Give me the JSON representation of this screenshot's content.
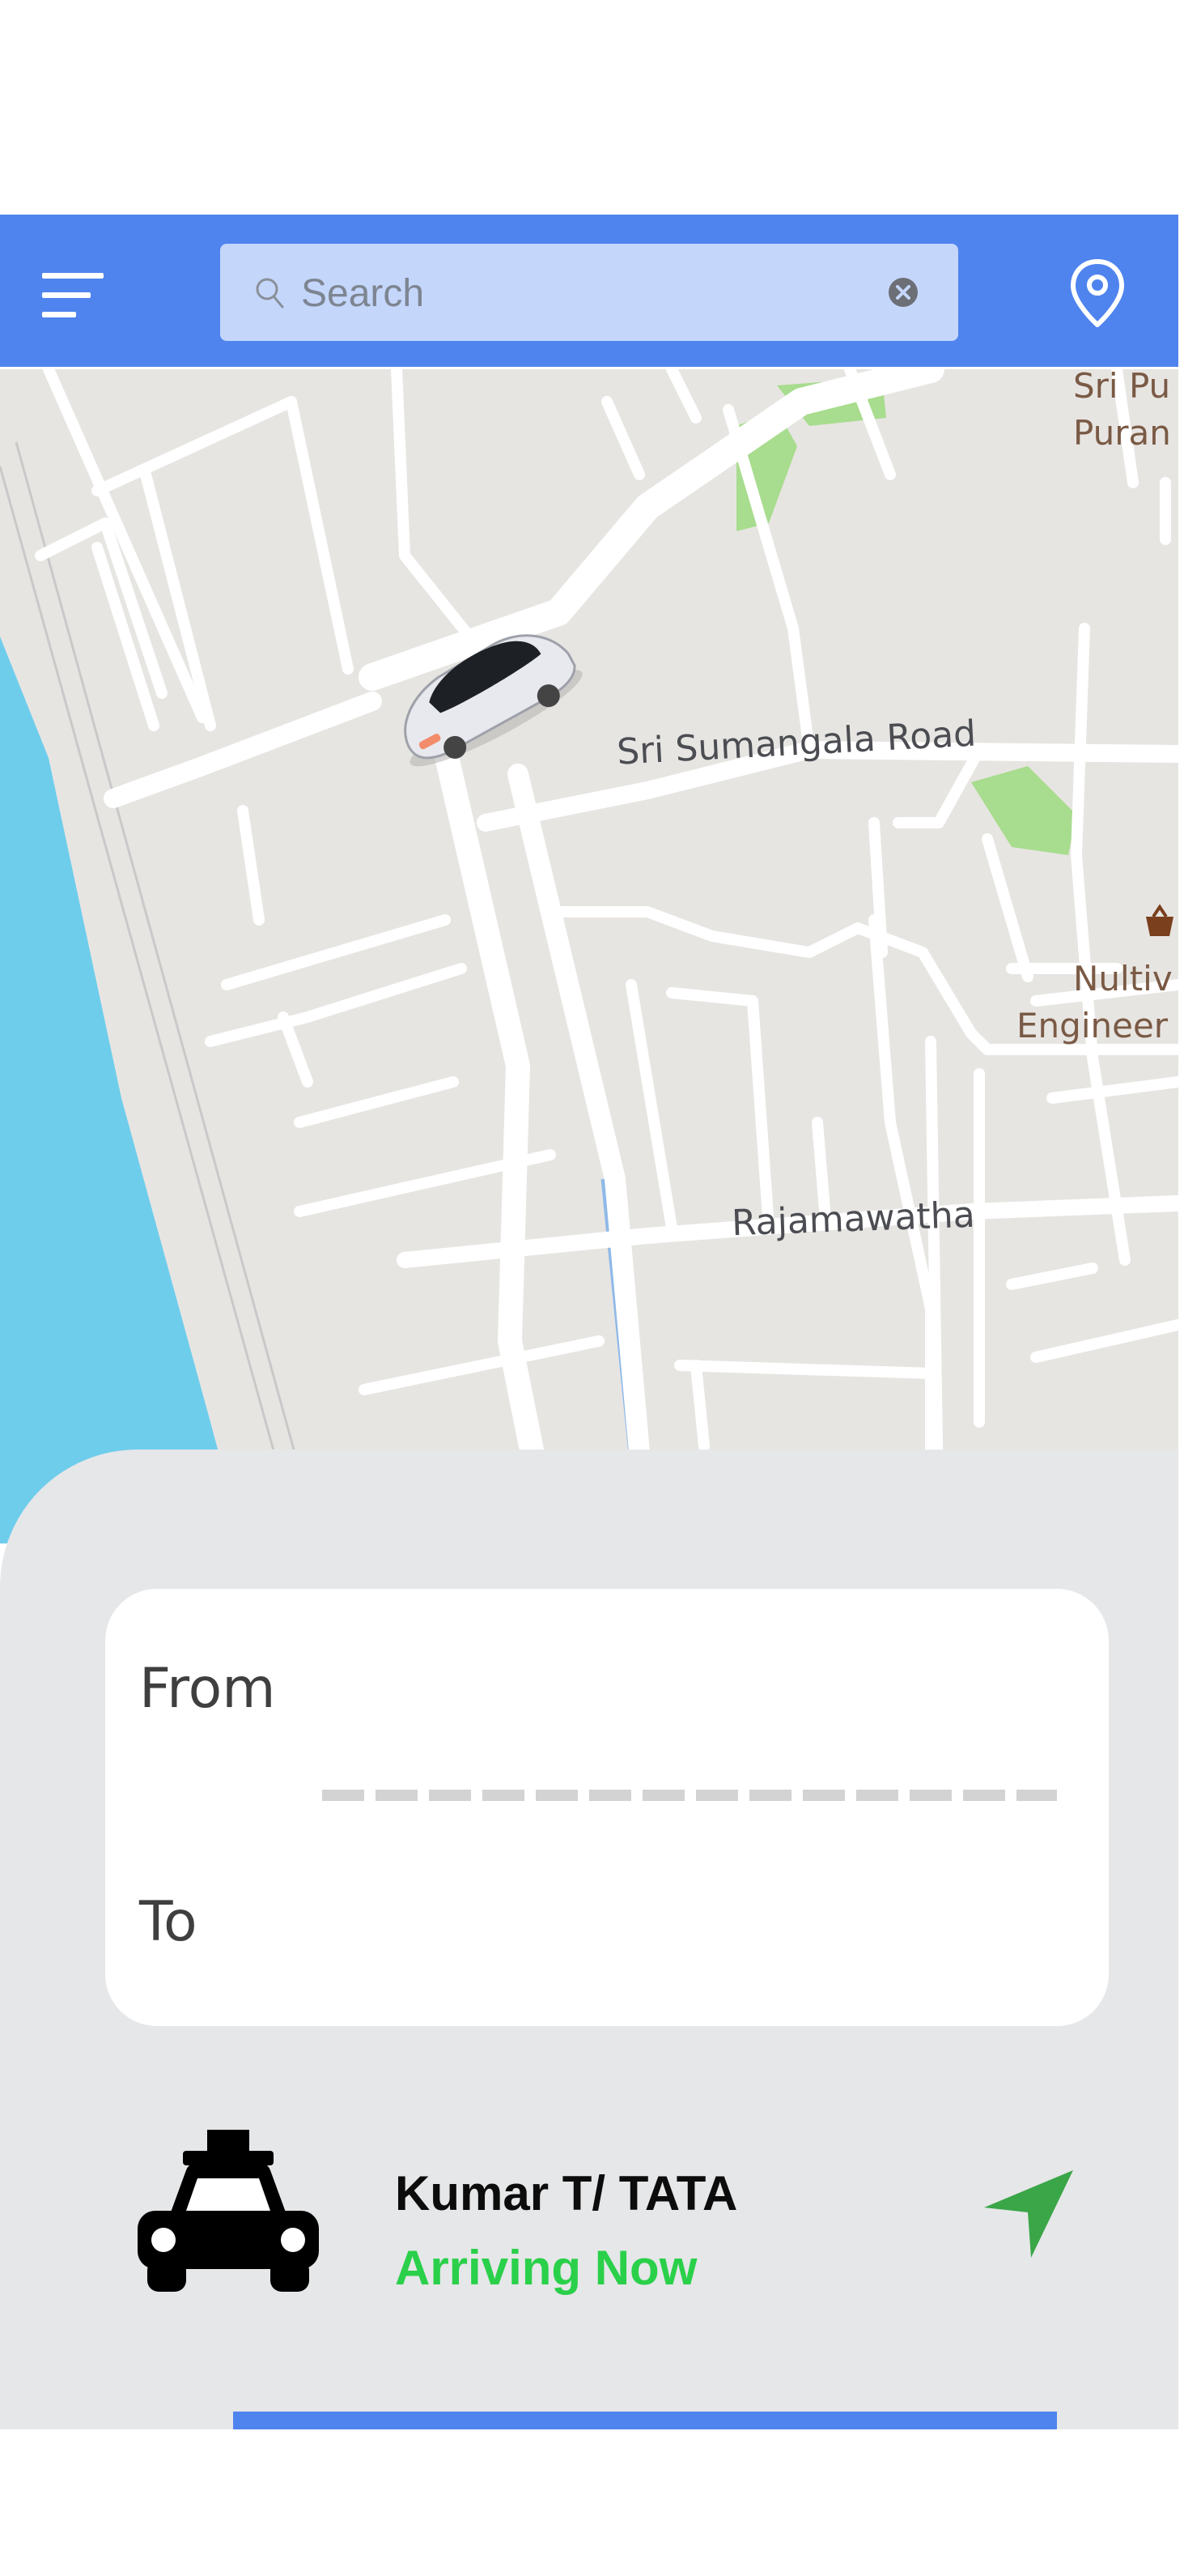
{
  "header": {
    "menu_icon": "hamburger-menu-icon",
    "search": {
      "placeholder": "Search",
      "value": ""
    },
    "search_icon": "search-icon",
    "clear_icon": "clear-icon",
    "location_icon": "map-pin-icon"
  },
  "map": {
    "labels": {
      "road_1": "Sri Sumangala Road",
      "road_2": "Rajamawatha",
      "place_1_line1": "Sri Pu",
      "place_1_line2": "Puran",
      "place_2_line1": "Nultiv",
      "place_2_line2": "Engineer"
    },
    "vehicle_icon": "car-icon"
  },
  "trip": {
    "from_label": "From",
    "to_label": "To"
  },
  "driver": {
    "name": "Kumar T/ TATA",
    "status": "Arriving Now",
    "vehicle_icon": "taxi-icon",
    "action_icon": "navigation-arrow-icon"
  },
  "colors": {
    "accent": "#4f84ee",
    "search_bg": "#c5d6fb",
    "status_green": "#2ad04a",
    "panel_bg": "#e6e7e9",
    "water": "#6fcdec",
    "park": "#a8dc8e"
  }
}
